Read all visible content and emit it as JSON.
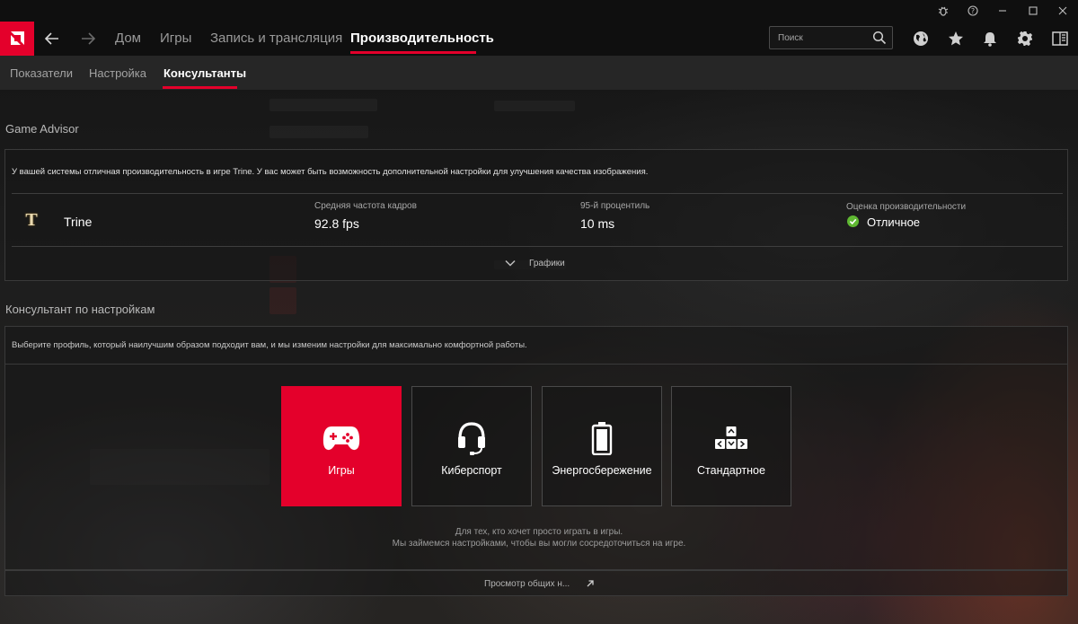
{
  "nav": {
    "tabs": [
      "Дом",
      "Игры",
      "Запись и трансляция",
      "Производительность"
    ],
    "active_tab": "Производительность"
  },
  "search": {
    "placeholder": "Поиск"
  },
  "subnav": {
    "tabs": [
      "Показатели",
      "Настройка",
      "Консультанты"
    ],
    "active_tab": "Консультанты"
  },
  "game_advisor": {
    "title": "Game Advisor",
    "message": "У вашей системы отличная производительность в игре Trine. У вас может быть возможность дополнительной настройки для улучшения качества изображения.",
    "game_name": "Trine",
    "game_icon_letter": "T",
    "metrics": {
      "avg_fps_label": "Средняя частота кадров",
      "avg_fps_value": "92.8 fps",
      "p95_label": "95-й процентиль",
      "p95_value": "10 ms",
      "rating_label": "Оценка производительности",
      "rating_value": "Отличное"
    },
    "expand_label": "Графики"
  },
  "settings_advisor": {
    "title": "Консультант по настройкам",
    "message": "Выберите профиль, который наилучшим образом подходит вам, и мы изменим настройки для максимально комфортной работы.",
    "profiles": [
      {
        "label": "Игры",
        "icon": "gamepad-icon",
        "active": true
      },
      {
        "label": "Киберспорт",
        "icon": "headset-icon",
        "active": false
      },
      {
        "label": "Энергосбережение",
        "icon": "battery-icon",
        "active": false
      },
      {
        "label": "Стандартное",
        "icon": "keys-icon",
        "active": false
      }
    ],
    "hint_line1": "Для тех, кто хочет просто играть в игры.",
    "hint_line2": "Мы займемся настройками, чтобы вы могли сосредоточиться на игре.",
    "view_link": "Просмотр общих н..."
  },
  "colors": {
    "accent": "#e4002b",
    "rating_green": "#5fb832"
  }
}
